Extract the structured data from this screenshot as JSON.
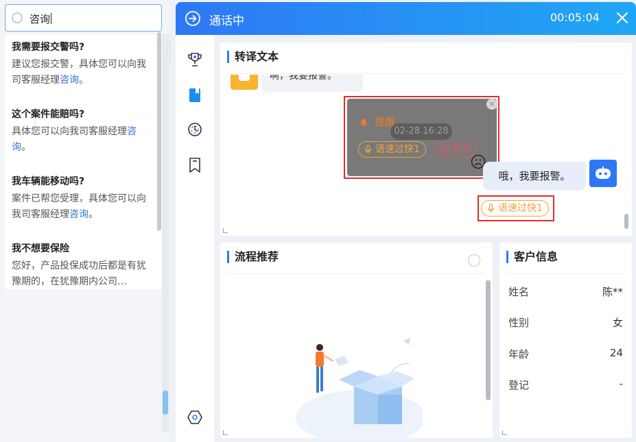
{
  "search": {
    "query": "咨询"
  },
  "results": [
    {
      "title": "我需要报交警吗?",
      "body": "建议您报交警，具体您可以向我司客服经理",
      "link": "咨询",
      "tail": "。"
    },
    {
      "title": "这个案件能赔吗?",
      "body": "具体您可以向我司客服经理",
      "link": "咨询",
      "tail": "。"
    },
    {
      "title": "我车辆能移动吗?",
      "body": "案件已帮您受理，具体您可以向我司客服经理",
      "link": "咨询",
      "tail": "。"
    },
    {
      "title": "我不想要保险",
      "body": "您好，产品投保成功后都是有犹豫期的，在犹豫期内公司…",
      "link": "",
      "tail": ""
    }
  ],
  "call": {
    "title": "通话中",
    "timer": "00:05:04"
  },
  "transcript": {
    "title": "转译文本",
    "top_bubble": "啊，我要报警。",
    "reminder": {
      "title": "提醒",
      "time": "02-28 16:28",
      "speed_tag": "语速过快1",
      "sentiment_tag": "负向",
      "close": "×"
    },
    "my_message": "哦，我要报警。",
    "speed_tag": "语速过快1"
  },
  "flow": {
    "title": "流程推荐"
  },
  "customer": {
    "title": "客户信息",
    "fields": [
      {
        "label": "姓名",
        "value": "陈**"
      },
      {
        "label": "性别",
        "value": "女"
      },
      {
        "label": "年龄",
        "value": "24"
      },
      {
        "label": "登记",
        "value": "-"
      }
    ]
  },
  "colors": {
    "accent": "#2f78f5",
    "warning": "#f0a33c",
    "alert": "#e52b2b",
    "remind_title": "#ef7a2a"
  },
  "icons": [
    "search-icon",
    "arrow-right-circle-icon",
    "close-icon",
    "trophy-icon",
    "book-icon",
    "clock-icon",
    "bookmark-icon",
    "settings-icon",
    "bell-icon",
    "mic-icon",
    "sad-face-icon",
    "robot-icon"
  ]
}
